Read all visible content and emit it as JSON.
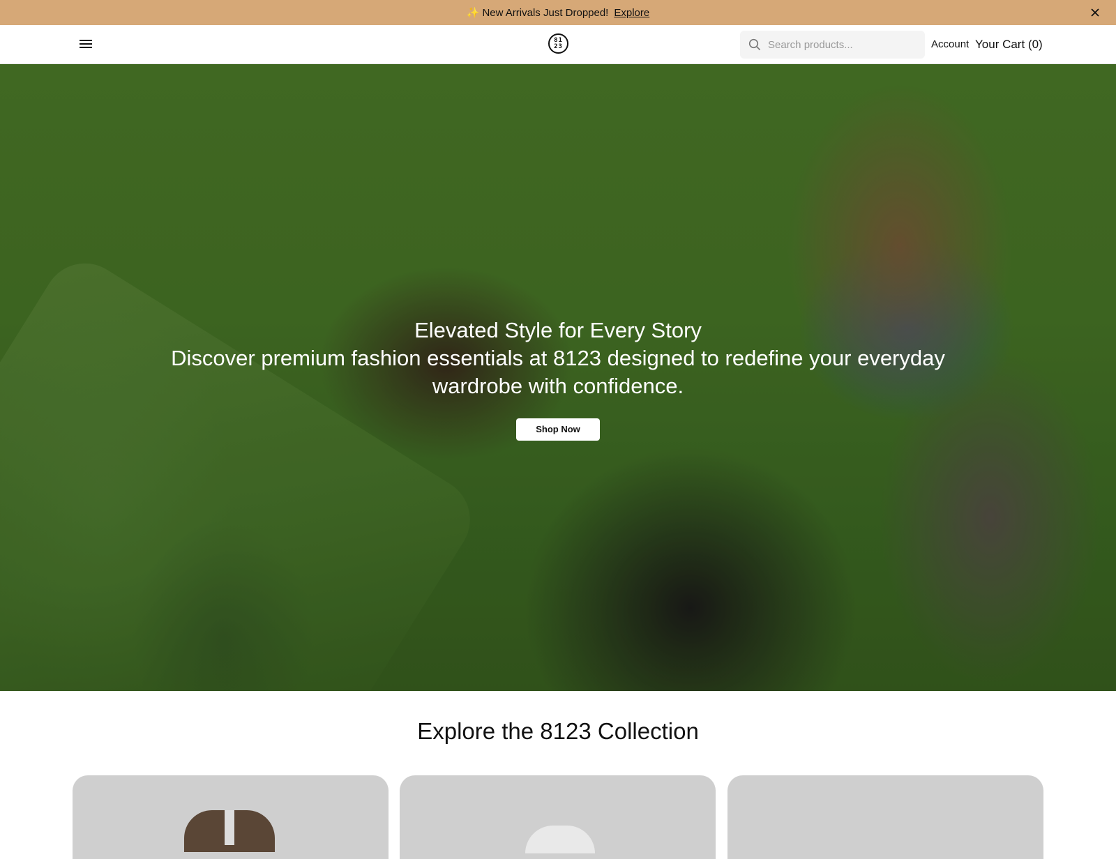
{
  "announcement": {
    "sparkle": "✨",
    "message": "New Arrivals Just Dropped!",
    "link": "Explore"
  },
  "header": {
    "logo_top": "81",
    "logo_bottom": "23",
    "search_placeholder": "Search products...",
    "account": "Account",
    "cart": "Your Cart (0)"
  },
  "hero": {
    "title": "Elevated Style for Every Story",
    "subtitle": "Discover premium fashion essentials at 8123 designed to redefine your everyday wardrobe with confidence.",
    "cta": "Shop Now"
  },
  "collection": {
    "title": "Explore the 8123 Collection"
  },
  "colors": {
    "announcement_bg": "#d6a877",
    "card_bg": "#cfcfcf"
  }
}
